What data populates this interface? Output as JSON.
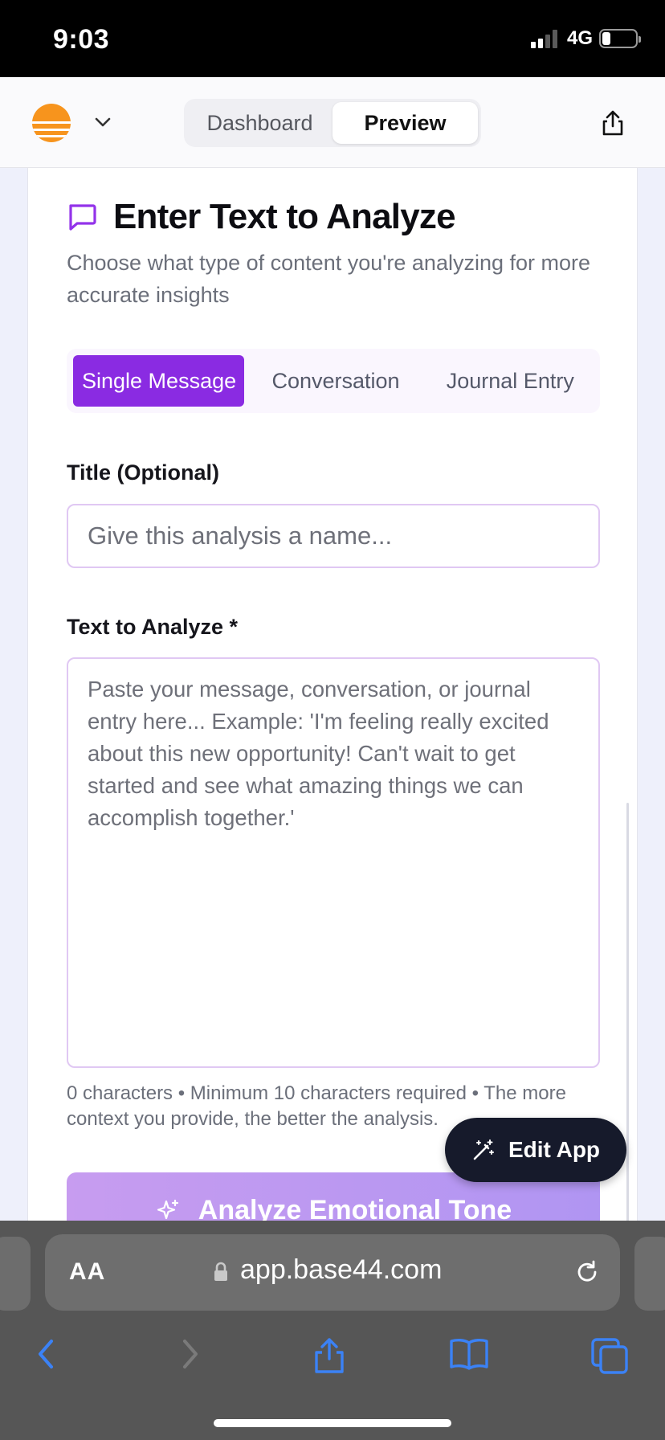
{
  "status_bar": {
    "time": "9:03",
    "network": "4G"
  },
  "header": {
    "tabs": [
      {
        "label": "Dashboard",
        "active": false
      },
      {
        "label": "Preview",
        "active": true
      }
    ]
  },
  "main": {
    "heading": "Enter Text to Analyze",
    "subtitle": "Choose what type of content you're analyzing for more accurate insights",
    "content_types": [
      {
        "label": "Single Message",
        "active": true
      },
      {
        "label": "Conversation",
        "active": false
      },
      {
        "label": "Journal Entry",
        "active": false
      }
    ],
    "title_field": {
      "label": "Title (Optional)",
      "placeholder": "Give this analysis a name...",
      "value": ""
    },
    "text_field": {
      "label": "Text to Analyze *",
      "placeholder": "Paste your message, conversation, or journal entry here... Example: 'I'm feeling really excited about this new opportunity! Can't wait to get started and see what amazing things we can accomplish together.'",
      "value": ""
    },
    "hint": "0 characters • Minimum 10 characters required • The more context you provide, the better the analysis.",
    "analyze_button": "Analyze Emotional Tone"
  },
  "floating": {
    "edit_app_label": "Edit App"
  },
  "browser": {
    "aa_label": "AA",
    "url": "app.base44.com"
  },
  "colors": {
    "accent": "#8a2be2",
    "field_border": "#e0c8f3",
    "edit_app_bg": "#161a2b",
    "browser_bg": "#565656",
    "ios_blue": "#3b82f6"
  }
}
